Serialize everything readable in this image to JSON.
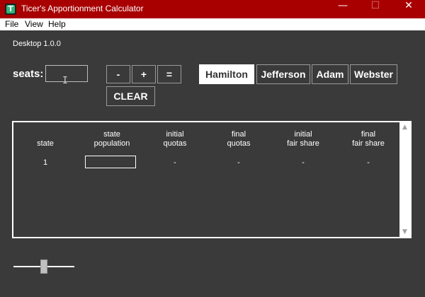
{
  "window": {
    "title": "Ticer's Apportionment Calculator",
    "icon_letter": "T",
    "minimize": "—",
    "maximize": "☐",
    "close": "✕"
  },
  "menu": [
    "File",
    "View",
    "Help"
  ],
  "version": "Desktop 1.0.0",
  "seats": {
    "label": "seats:",
    "value": ""
  },
  "controls": {
    "minus": "-",
    "plus": "+",
    "equals": "=",
    "clear": "CLEAR"
  },
  "methods": [
    {
      "label": "Hamilton",
      "selected": true
    },
    {
      "label": "Jefferson",
      "selected": false
    },
    {
      "label": "Adam",
      "selected": false
    },
    {
      "label": "Webster",
      "selected": false
    }
  ],
  "table": {
    "headers": [
      [
        "",
        "state"
      ],
      [
        "state",
        "population"
      ],
      [
        "initial",
        "quotas"
      ],
      [
        "final",
        "quotas"
      ],
      [
        "initial",
        "fair share"
      ],
      [
        "final",
        "fair share"
      ]
    ],
    "rows": [
      {
        "state": "1",
        "population": "",
        "initial_quota": "-",
        "final_quota": "-",
        "initial_fair_share": "-",
        "final_fair_share": "-"
      }
    ]
  },
  "slider": {
    "value": 0.5
  },
  "colors": {
    "titlebar": "#a80000",
    "background": "#3a3a3a",
    "accent": "#ffffff"
  }
}
